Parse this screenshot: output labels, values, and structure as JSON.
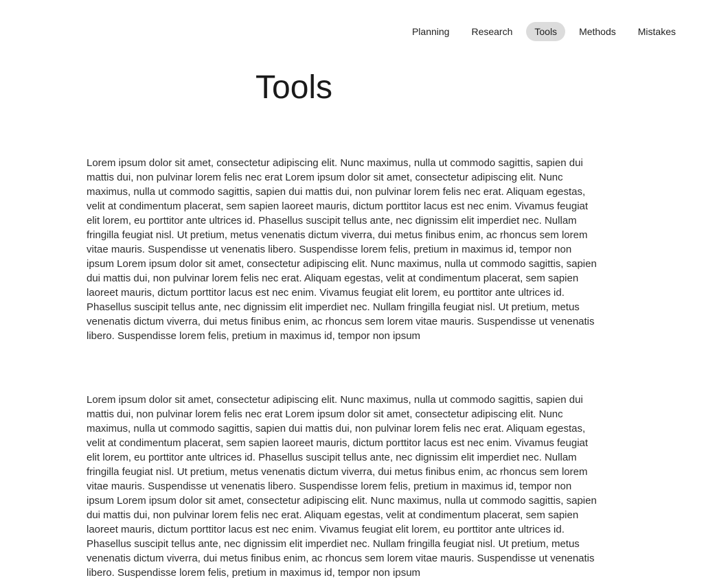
{
  "nav": {
    "items": [
      {
        "label": "Planning",
        "active": false
      },
      {
        "label": "Research",
        "active": false
      },
      {
        "label": "Tools",
        "active": true
      },
      {
        "label": "Methods",
        "active": false
      },
      {
        "label": "Mistakes",
        "active": false
      }
    ]
  },
  "page": {
    "title": "Tools"
  },
  "content": {
    "paragraphs": [
      "Lorem ipsum dolor sit amet, consectetur adipiscing elit. Nunc maximus, nulla ut commodo sagittis, sapien dui mattis dui, non pulvinar lorem felis nec erat Lorem ipsum dolor sit amet, consectetur adipiscing elit. Nunc maximus, nulla ut commodo sagittis, sapien dui mattis dui, non pulvinar lorem felis nec erat. Aliquam egestas, velit at condimentum placerat, sem sapien laoreet mauris, dictum porttitor lacus est nec enim. Vivamus feugiat elit lorem, eu porttitor ante ultrices id. Phasellus suscipit tellus ante, nec dignissim elit imperdiet nec. Nullam fringilla feugiat nisl. Ut pretium, metus venenatis dictum viverra, dui metus finibus enim, ac rhoncus sem lorem vitae mauris. Suspendisse ut venenatis libero. Suspendisse lorem felis, pretium in maximus id, tempor non ipsum Lorem ipsum dolor sit amet, consectetur adipiscing elit. Nunc maximus, nulla ut commodo sagittis, sapien dui mattis dui, non pulvinar lorem felis nec erat. Aliquam egestas, velit at condimentum placerat, sem sapien laoreet mauris, dictum porttitor lacus est nec enim. Vivamus feugiat elit lorem, eu porttitor ante ultrices id. Phasellus suscipit tellus ante, nec dignissim elit imperdiet nec. Nullam fringilla feugiat nisl. Ut pretium, metus venenatis dictum viverra, dui metus finibus enim, ac rhoncus sem lorem vitae mauris. Suspendisse ut venenatis libero. Suspendisse lorem felis, pretium in maximus id, tempor non ipsum",
      "Lorem ipsum dolor sit amet, consectetur adipiscing elit. Nunc maximus, nulla ut commodo sagittis, sapien dui mattis dui, non pulvinar lorem felis nec erat Lorem ipsum dolor sit amet, consectetur adipiscing elit. Nunc maximus, nulla ut commodo sagittis, sapien dui mattis dui, non pulvinar lorem felis nec erat. Aliquam egestas, velit at condimentum placerat, sem sapien laoreet mauris, dictum porttitor lacus est nec enim. Vivamus feugiat elit lorem, eu porttitor ante ultrices id. Phasellus suscipit tellus ante, nec dignissim elit imperdiet nec. Nullam fringilla feugiat nisl. Ut pretium, metus venenatis dictum viverra, dui metus finibus enim, ac rhoncus sem lorem vitae mauris. Suspendisse ut venenatis libero. Suspendisse lorem felis, pretium in maximus id, tempor non ipsum Lorem ipsum dolor sit amet, consectetur adipiscing elit. Nunc maximus, nulla ut commodo sagittis, sapien dui mattis dui, non pulvinar lorem felis nec erat. Aliquam egestas, velit at condimentum placerat, sem sapien laoreet mauris, dictum porttitor lacus est nec enim. Vivamus feugiat elit lorem, eu porttitor ante ultrices id. Phasellus suscipit tellus ante, nec dignissim elit imperdiet nec. Nullam fringilla feugiat nisl. Ut pretium, metus venenatis dictum viverra, dui metus finibus enim, ac rhoncus sem lorem vitae mauris. Suspendisse ut venenatis libero. Suspendisse lorem felis, pretium in maximus id, tempor non ipsum"
    ]
  }
}
